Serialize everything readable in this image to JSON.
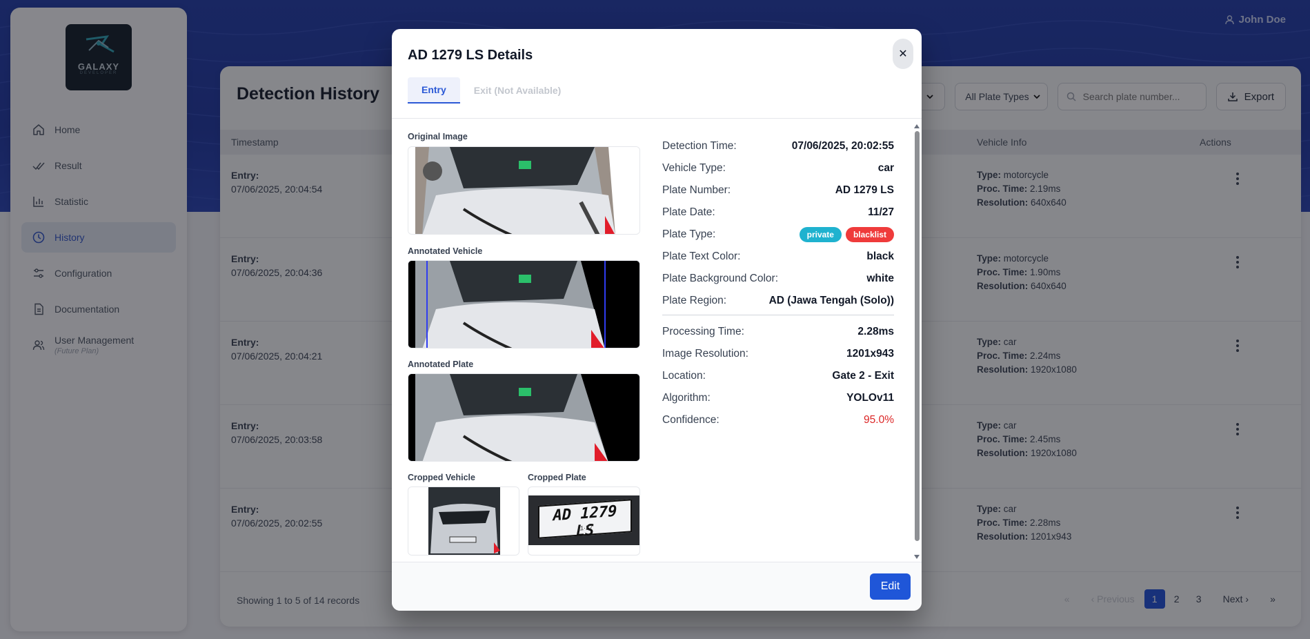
{
  "user": {
    "name": "John Doe"
  },
  "logo": {
    "text": "GALAXY",
    "subtext": "DEVELOPER"
  },
  "sidebar": {
    "items": [
      {
        "label": "Home",
        "icon": "home-icon"
      },
      {
        "label": "Result",
        "icon": "check-double-icon"
      },
      {
        "label": "Statistic",
        "icon": "bar-chart-icon"
      },
      {
        "label": "History",
        "icon": "clock-icon",
        "active": true
      },
      {
        "label": "Configuration",
        "icon": "sliders-icon"
      },
      {
        "label": "Documentation",
        "icon": "document-icon"
      },
      {
        "label": "User Management",
        "sublabel": "(Future Plan)",
        "icon": "users-icon"
      }
    ]
  },
  "history": {
    "title": "Detection History",
    "filters": {
      "plate_types": "All Plate Types",
      "search_placeholder": "Search plate number...",
      "export_label": "Export"
    },
    "columns": {
      "timestamp": "Timestamp",
      "vehicle_info": "Vehicle Info",
      "actions": "Actions"
    },
    "rows": [
      {
        "entry_label": "Entry:",
        "time": "07/06/2025, 20:04:54",
        "type": "motorcycle",
        "proc": "2.19ms",
        "res": "640x640"
      },
      {
        "entry_label": "Entry:",
        "time": "07/06/2025, 20:04:36",
        "type": "motorcycle",
        "proc": "1.90ms",
        "res": "640x640"
      },
      {
        "entry_label": "Entry:",
        "time": "07/06/2025, 20:04:21",
        "type": "car",
        "proc": "2.24ms",
        "res": "1920x1080"
      },
      {
        "entry_label": "Entry:",
        "time": "07/06/2025, 20:03:58",
        "type": "car",
        "proc": "2.45ms",
        "res": "1920x1080"
      },
      {
        "entry_label": "Entry:",
        "time": "07/06/2025, 20:02:55",
        "type": "car",
        "proc": "2.28ms",
        "res": "1201x943"
      }
    ],
    "vehicle_info_labels": {
      "type": "Type:",
      "proc": "Proc. Time:",
      "res": "Resolution:"
    },
    "footer": "Showing 1 to 5 of 14 records",
    "pager": {
      "first": "«",
      "previous": "Previous",
      "pages": [
        "1",
        "2",
        "3"
      ],
      "current": "1",
      "next": "Next",
      "last": "»"
    }
  },
  "modal": {
    "title": "AD 1279 LS Details",
    "tabs": {
      "entry": "Entry",
      "exit": "Exit (Not Available)"
    },
    "images": {
      "original": "Original Image",
      "annotated_vehicle": "Annotated Vehicle",
      "annotated_plate": "Annotated Plate",
      "cropped_vehicle": "Cropped Vehicle",
      "cropped_plate": "Cropped Plate",
      "plate_text": "AD 1279 LS",
      "plate_subtext": "11·27"
    },
    "details": [
      {
        "key": "Detection Time:",
        "value": "07/06/2025, 20:02:55"
      },
      {
        "key": "Vehicle Type:",
        "value": "car"
      },
      {
        "key": "Plate Number:",
        "value": "AD 1279 LS"
      },
      {
        "key": "Plate Date:",
        "value": "11/27"
      }
    ],
    "plate_type": {
      "key": "Plate Type:",
      "badges": [
        {
          "label": "private",
          "color": "#1fb2cf"
        },
        {
          "label": "blacklist",
          "color": "#ef3b3b"
        }
      ]
    },
    "details2": [
      {
        "key": "Plate Text Color:",
        "value": "black"
      },
      {
        "key": "Plate Background Color:",
        "value": "white"
      },
      {
        "key": "Plate Region:",
        "value": "AD (Jawa Tengah (Solo))"
      }
    ],
    "details3": [
      {
        "key": "Processing Time:",
        "value": "2.28ms"
      },
      {
        "key": "Image Resolution:",
        "value": "1201x943"
      },
      {
        "key": "Location:",
        "value": "Gate 2 - Exit"
      },
      {
        "key": "Algorithm:",
        "value": "YOLOv11"
      },
      {
        "key": "Confidence:",
        "value": "95.0%",
        "color": "#dc2626"
      }
    ],
    "edit_label": "Edit"
  },
  "colors": {
    "accent": "#1f56d8",
    "hero": "#1e3aa8",
    "confidence": "#dc2626"
  }
}
